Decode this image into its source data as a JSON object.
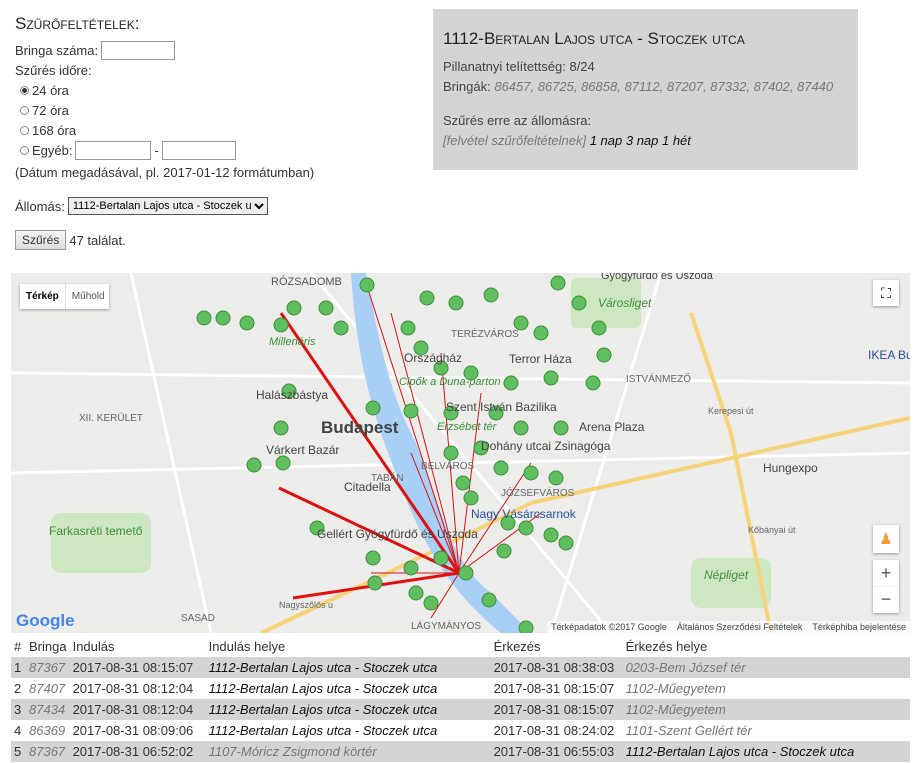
{
  "filter": {
    "title": "Szűrőfeltételek:",
    "bike_label": "Bringa száma:",
    "bike_value": "",
    "period_label": "Szűrés időre:",
    "options": [
      "24 óra",
      "72 óra",
      "168 óra"
    ],
    "other_label": "Egyéb:",
    "date_from": "",
    "date_sep": "-",
    "date_to": "",
    "date_hint": "(Dátum megadásával, pl. 2017-01-12 formátumban)",
    "station_label": "Állomás:",
    "station_value": "1112-Bertalan Lajos utca - Stoczek utca",
    "submit": "Szűrés",
    "result_count": "47 találat."
  },
  "info": {
    "title": "1112-Bertalan Lajos utca - Stoczek utca",
    "occupancy": "Pillanatnyi telítettség: 8/24",
    "bikes_label": "Bringák:",
    "bikes": "86457, 86725, 86858, 87112, 87207, 87332, 87402, 87440",
    "filter_label": "Szűrés erre az állomásra:",
    "add_filter": "[felvétel szűrőfeltételnek]",
    "quick": "1 nap 3 nap 1 hét"
  },
  "map": {
    "type_map": "Térkép",
    "type_sat": "Műhold",
    "labels": [
      "RÓZSADOMB",
      "Millenáris",
      "Halászbástya",
      "Budapest",
      "Várkert Bazár",
      "Országház",
      "Terror Háza",
      "Cipők a Duna-parton",
      "Szent István Bazilika",
      "Erzsébet tér",
      "Dohány utcai Zsinagóga",
      "Citadella",
      "Nagy Vásárcsarnok",
      "Gellért Gyógyfürdő és Uszoda",
      "BELVÁROS",
      "JÓZSEFVÁROS",
      "TABÁN",
      "XII. KERÜLET",
      "Farkasréti temető",
      "Városliget",
      "ISTVÁNMEZŐ",
      "Arena Plaza",
      "Hungexpo",
      "IKEA Bu",
      "Népliget",
      "SASAD",
      "LÁGYMÁNYOS",
      "TERÉZVÁROS",
      "Gyógyfürdő és Uszoda",
      "Kerepesi út",
      "Kőbányai út",
      "Nagyszőlős u"
    ],
    "google": "Google",
    "attribution": "Térképadatok ©2017 Google",
    "terms": "Általános Szerződési Feltételek",
    "report": "Térképhiba bejelentése"
  },
  "table": {
    "headers": [
      "#",
      "Bringa",
      "Indulás",
      "Indulás helye",
      "Érkezés",
      "Érkezés helye"
    ],
    "rows": [
      [
        "1",
        "87367",
        "2017-08-31 08:15:07",
        "1112-Bertalan Lajos utca - Stoczek utca",
        "2017-08-31 08:38:03",
        "0203-Bem József tér"
      ],
      [
        "2",
        "87407",
        "2017-08-31 08:12:04",
        "1112-Bertalan Lajos utca - Stoczek utca",
        "2017-08-31 08:15:07",
        "1102-Műegyetem"
      ],
      [
        "3",
        "87434",
        "2017-08-31 08:12:04",
        "1112-Bertalan Lajos utca - Stoczek utca",
        "2017-08-31 08:15:07",
        "1102-Műegyetem"
      ],
      [
        "4",
        "86369",
        "2017-08-31 08:09:06",
        "1112-Bertalan Lajos utca - Stoczek utca",
        "2017-08-31 08:24:02",
        "1101-Szent Gellért tér"
      ],
      [
        "5",
        "87367",
        "2017-08-31 06:52:02",
        "1107-Móricz Zsigmond körtér",
        "2017-08-31 06:55:03",
        "1112-Bertalan Lajos utca - Stoczek utca"
      ]
    ]
  },
  "colors": {
    "panel": "#d4d4d4",
    "route": "#e01010",
    "marker": "#5fbf5f",
    "river": "#a8cff5"
  }
}
